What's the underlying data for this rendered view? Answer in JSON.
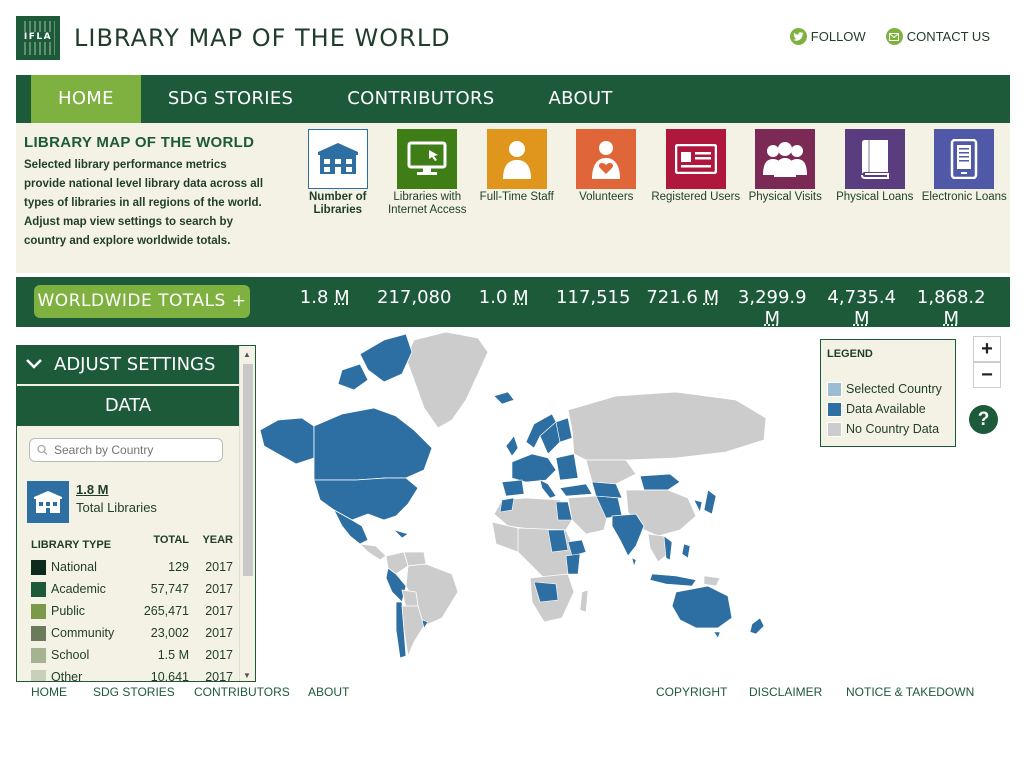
{
  "header": {
    "logo_text": "IFLA",
    "title": "LIBRARY MAP OF THE WORLD",
    "follow_label": "FOLLOW",
    "contact_label": "CONTACT US"
  },
  "nav": {
    "items": [
      "HOME",
      "SDG STORIES",
      "CONTRIBUTORS",
      "ABOUT"
    ],
    "active": "HOME"
  },
  "intro": {
    "title": "LIBRARY MAP OF THE WORLD",
    "text": "Selected library performance metrics provide national level library data across all types of libraries in all regions of the world. Adjust map view settings to search by country and explore worldwide totals."
  },
  "metrics": [
    {
      "label": "Number of Libraries",
      "color": "#ffffff",
      "icon": "library-building-icon",
      "selected": true
    },
    {
      "label": "Libraries with Internet Access",
      "color": "#3f7d17",
      "icon": "monitor-cursor-icon"
    },
    {
      "label": "Full-Time Staff",
      "color": "#e0961c",
      "icon": "person-icon"
    },
    {
      "label": "Volunteers",
      "color": "#e0663a",
      "icon": "volunteer-heart-icon"
    },
    {
      "label": "Registered Users",
      "color": "#b0173c",
      "icon": "id-card-icon"
    },
    {
      "label": "Physical Visits",
      "color": "#7a2a55",
      "icon": "people-group-icon"
    },
    {
      "label": "Physical Loans",
      "color": "#5a3d7e",
      "icon": "book-icon"
    },
    {
      "label": "Electronic Loans",
      "color": "#5058a8",
      "icon": "e-reader-icon"
    }
  ],
  "totals": {
    "button_label": "WORLDWIDE TOTALS",
    "values": [
      {
        "num": "1.8",
        "unit": "M"
      },
      {
        "num": "217,080",
        "unit": ""
      },
      {
        "num": "1.0",
        "unit": "M"
      },
      {
        "num": "117,515",
        "unit": ""
      },
      {
        "num": "721.6",
        "unit": "M"
      },
      {
        "num": "3,299.9",
        "unit": "M"
      },
      {
        "num": "4,735.4",
        "unit": "M"
      },
      {
        "num": "1,868.2",
        "unit": "M"
      }
    ]
  },
  "panel": {
    "adjust_label": "ADJUST SETTINGS",
    "data_label": "DATA",
    "search_placeholder": "Search by Country",
    "total_value": "1.8 M",
    "total_label": "Total Libraries",
    "table_headers": [
      "LIBRARY TYPE",
      "TOTAL",
      "YEAR"
    ],
    "rows": [
      {
        "type": "National",
        "total": "129",
        "year": "2017",
        "color": "#0e2a1c"
      },
      {
        "type": "Academic",
        "total": "57,747",
        "year": "2017",
        "color": "#1c5a3a"
      },
      {
        "type": "Public",
        "total": "265,471",
        "year": "2017",
        "color": "#7a9a4a"
      },
      {
        "type": "Community",
        "total": "23,002",
        "year": "2017",
        "color": "#6b7a5a"
      },
      {
        "type": "School",
        "total": "1.5 M",
        "year": "2017",
        "color": "#a6b390"
      },
      {
        "type": "Other",
        "total": "10,641",
        "year": "2017",
        "color": "#c9d0b8"
      }
    ]
  },
  "legend": {
    "title": "LEGEND",
    "items": [
      {
        "label": "Selected Country",
        "color": "#9bbcd1"
      },
      {
        "label": "Data Available",
        "color": "#2d6fa3"
      },
      {
        "label": "No Country Data",
        "color": "#cccccc"
      }
    ]
  },
  "map_controls": {
    "zoom_in": "+",
    "zoom_out": "−",
    "help": "?"
  },
  "footer": {
    "left": [
      "HOME",
      "SDG STORIES",
      "CONTRIBUTORS",
      "ABOUT"
    ],
    "right": [
      "COPYRIGHT",
      "DISCLAIMER",
      "NOTICE & TAKEDOWN"
    ]
  }
}
